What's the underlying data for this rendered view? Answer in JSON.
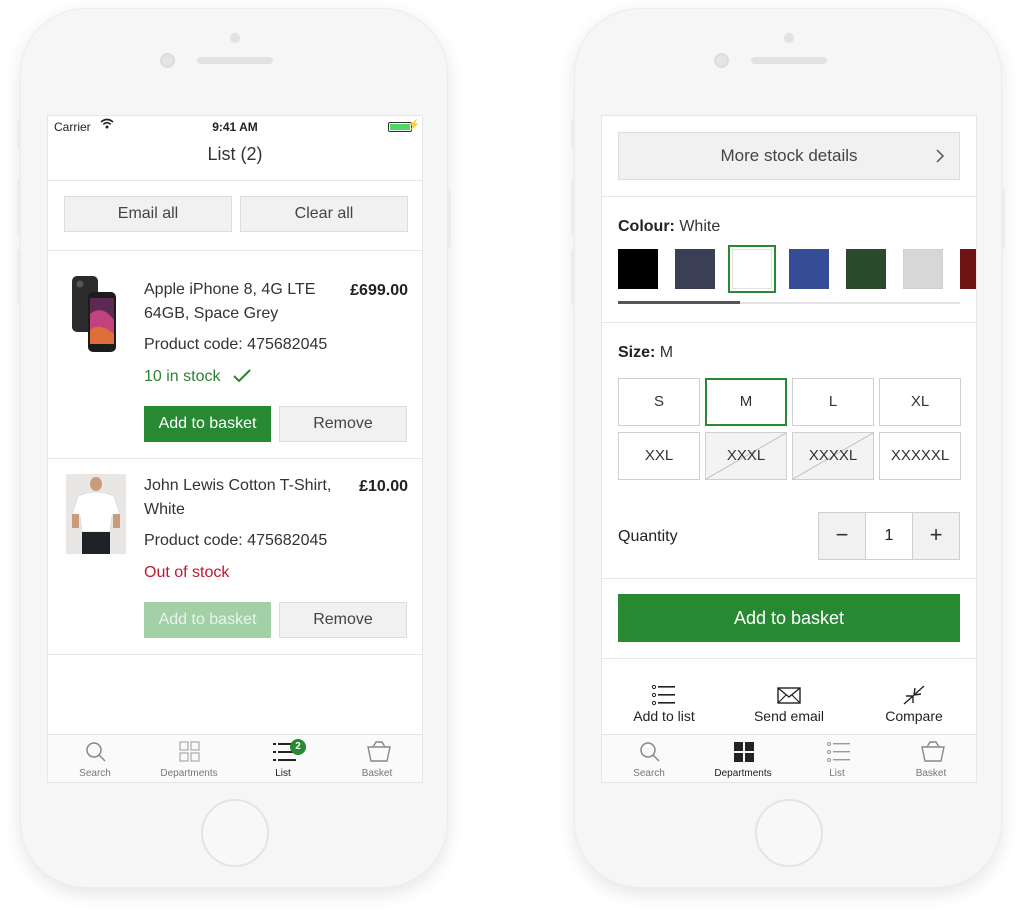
{
  "left_screen": {
    "status": {
      "carrier": "Carrier",
      "time": "9:41 AM"
    },
    "title": "List (2)",
    "email_all": "Email all",
    "clear_all": "Clear all",
    "products": [
      {
        "name_line1": "Apple iPhone 8, 4G LTE",
        "name_line2": "64GB, Space Grey",
        "price": "£699.00",
        "code": "Product code: 475682045",
        "stock": "10 in stock",
        "in_stock": true,
        "add_label": "Add to basket",
        "remove_label": "Remove"
      },
      {
        "name_line1": "John Lewis Cotton T-Shirt,",
        "name_line2": "White",
        "price": "£10.00",
        "code": "Product code: 475682045",
        "stock": "Out of stock",
        "in_stock": false,
        "add_label": "Add to basket",
        "remove_label": "Remove"
      }
    ],
    "tabs": [
      {
        "label": "Search",
        "icon": "search-icon"
      },
      {
        "label": "Departments",
        "icon": "grid-outline-icon"
      },
      {
        "label": "List",
        "icon": "list-icon",
        "badge": "2",
        "active": true
      },
      {
        "label": "Basket",
        "icon": "basket-icon"
      }
    ]
  },
  "right_screen": {
    "stock_details": "More stock details",
    "colour_label": "Colour:",
    "colour_value": "White",
    "colours": [
      "#000000",
      "#3a3f55",
      "#ffffff",
      "#354d96",
      "#2a4a2c",
      "#d7d7d7",
      "#6e1414"
    ],
    "selected_colour_index": 2,
    "size_label": "Size:",
    "size_value": "M",
    "sizes": [
      {
        "label": "S",
        "available": true
      },
      {
        "label": "M",
        "available": true,
        "selected": true
      },
      {
        "label": "L",
        "available": true
      },
      {
        "label": "XL",
        "available": true
      },
      {
        "label": "XXL",
        "available": true
      },
      {
        "label": "XXXL",
        "available": false
      },
      {
        "label": "XXXXL",
        "available": false
      },
      {
        "label": "XXXXXL",
        "available": true
      }
    ],
    "quantity_label": "Quantity",
    "quantity": "1",
    "minus": "−",
    "plus": "+",
    "add_to_basket": "Add to basket",
    "actions": [
      {
        "label": "Add to list",
        "icon": "list-add-icon"
      },
      {
        "label": "Send email",
        "icon": "envelope-icon"
      },
      {
        "label": "Compare",
        "icon": "compare-arrows-icon"
      }
    ],
    "tabs": [
      {
        "label": "Search",
        "icon": "search-icon"
      },
      {
        "label": "Departments",
        "icon": "grid-filled-icon",
        "active": true
      },
      {
        "label": "List",
        "icon": "list-icon"
      },
      {
        "label": "Basket",
        "icon": "basket-icon"
      }
    ]
  },
  "colors": {
    "green": "#278931",
    "green_disabled": "#a4d0a7",
    "in_stock_text": "#2a8430",
    "out_of_stock_text": "#c0182f"
  }
}
